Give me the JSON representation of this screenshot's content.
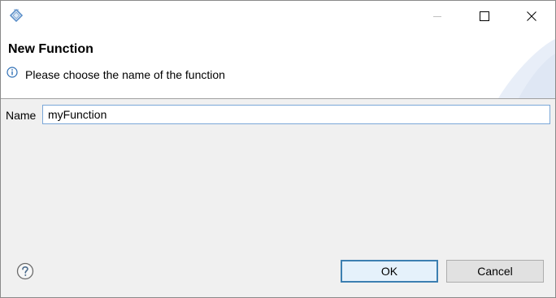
{
  "dialog": {
    "title": "New Function",
    "message": "Please choose the name of the function"
  },
  "form": {
    "name_label": "Name",
    "name_value": "myFunction"
  },
  "buttons": {
    "ok_label": "OK",
    "cancel_label": "Cancel"
  },
  "icons": {
    "app": "eclipse-diamond-icon",
    "info": "info-icon",
    "help": "help-question-icon",
    "minimize": "minimize-icon",
    "maximize": "maximize-icon",
    "close": "close-icon"
  },
  "colors": {
    "accent_blue": "#3c7fb1",
    "input_border": "#7aa7d8",
    "dialog_bg": "#f0f0f0"
  }
}
